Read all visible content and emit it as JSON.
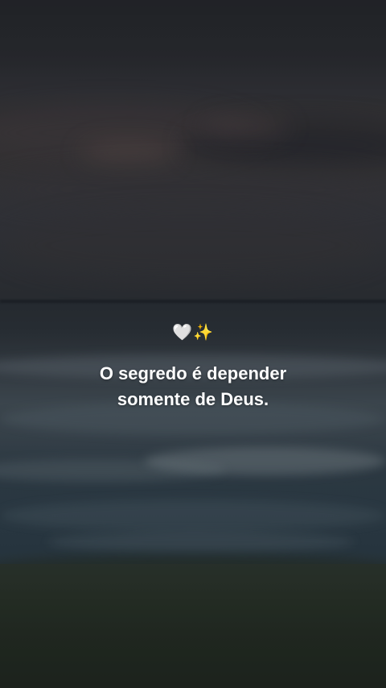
{
  "caption": {
    "emoji_heart": "🤍",
    "emoji_sparkles": "✨",
    "line1": "O segredo é depender",
    "line2": "somente de Deus."
  },
  "colors": {
    "text": "#ffffff",
    "sky": "#34353a",
    "sea": "#3f4c55",
    "shore": "#252e24"
  },
  "icons": [
    "white-heart-icon",
    "sparkles-icon"
  ]
}
